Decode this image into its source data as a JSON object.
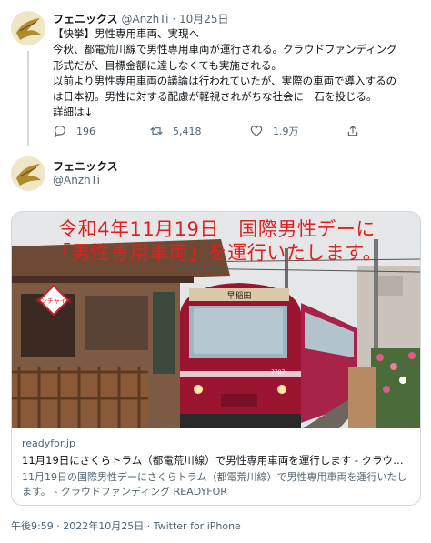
{
  "tweet1": {
    "display_name": "フェニックス",
    "handle": "@AnzhTi",
    "separator": "·",
    "date": "10月25日",
    "lines": [
      "【快挙】男性専用車両、実現へ",
      "今秋、都電荒川線で男性専用車両が運行される。クラウドファンディング",
      "形式だが、目標金額に達しなくても実施される。",
      "以前より男性専用車両の議論は行われていたが、実際の車両で導入するの",
      "は日本初。男性に対する配慮が軽視されがちな社会に一石を投じる。",
      "詳細は↓"
    ],
    "actions": {
      "reply_count": "196",
      "retweet_count": "5,418",
      "like_count": "1.9万"
    }
  },
  "tweet2": {
    "display_name": "フェニックス",
    "handle": "@AnzhTi"
  },
  "card": {
    "image_overlay_line1": "令和4年11月19日　国際男性デーに",
    "image_overlay_line2": "「男性専用車両」を運行いたします。",
    "sign_text": "キンチャイル",
    "tram_destination": "早稲田",
    "tram_number": "7707",
    "domain": "readyfor.jp",
    "title": "11月19日にさくらトラム（都電荒川線）で男性専用車両を運行します - クラウ…",
    "description": "11月19日の国際男性デーにさくらトラム（都電荒川線）で男性専用車両を運行いたします。 - クラウドファンディング READYFOR"
  },
  "meta": {
    "time": "午後9:59",
    "separator": " · ",
    "date": "2022年10月25日",
    "source": "Twitter for iPhone"
  },
  "colors": {
    "text": "#0f1419",
    "secondary": "#536471",
    "border": "#cfd9de",
    "overlay_red": "#e02020",
    "tram_red": "#9b1530"
  }
}
